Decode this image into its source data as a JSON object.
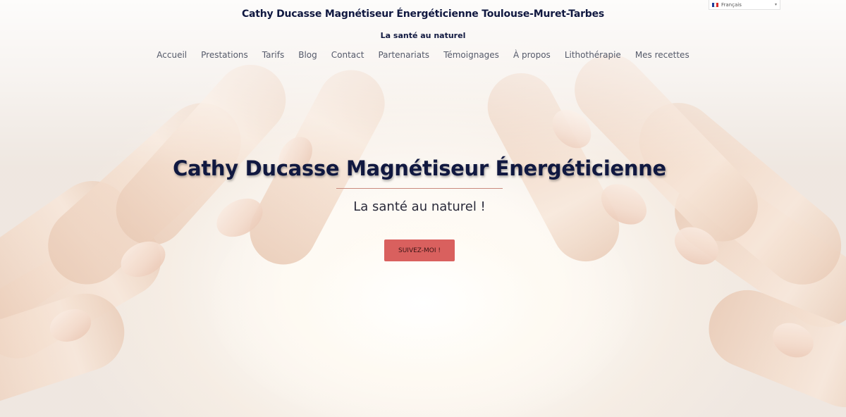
{
  "header": {
    "site_title": "Cathy Ducasse Magnétiseur Énergéticienne Toulouse-Muret-Tarbes",
    "tagline": "La santé au naturel"
  },
  "nav": {
    "items": [
      {
        "label": "Accueil"
      },
      {
        "label": "Prestations"
      },
      {
        "label": "Tarifs"
      },
      {
        "label": "Blog"
      },
      {
        "label": "Contact"
      },
      {
        "label": "Partenariats"
      },
      {
        "label": "Témoignages"
      },
      {
        "label": "À propos"
      },
      {
        "label": "Lithothérapie"
      },
      {
        "label": "Mes recettes"
      }
    ]
  },
  "language_selector": {
    "selected": "Français",
    "flag_icon": "france-flag-icon",
    "colors": [
      "#1f3d99",
      "#ffffff",
      "#d92b2b"
    ]
  },
  "hero": {
    "title": "Cathy Ducasse Magnétiseur Énergéticienne",
    "subtitle": "La santé au naturel !",
    "cta_label": "SUIVEZ-MOI !"
  },
  "colors": {
    "title_text": "#101840",
    "nav_text": "#555a6a",
    "cta_background": "#d9605e",
    "divider": "#c98a7e"
  }
}
